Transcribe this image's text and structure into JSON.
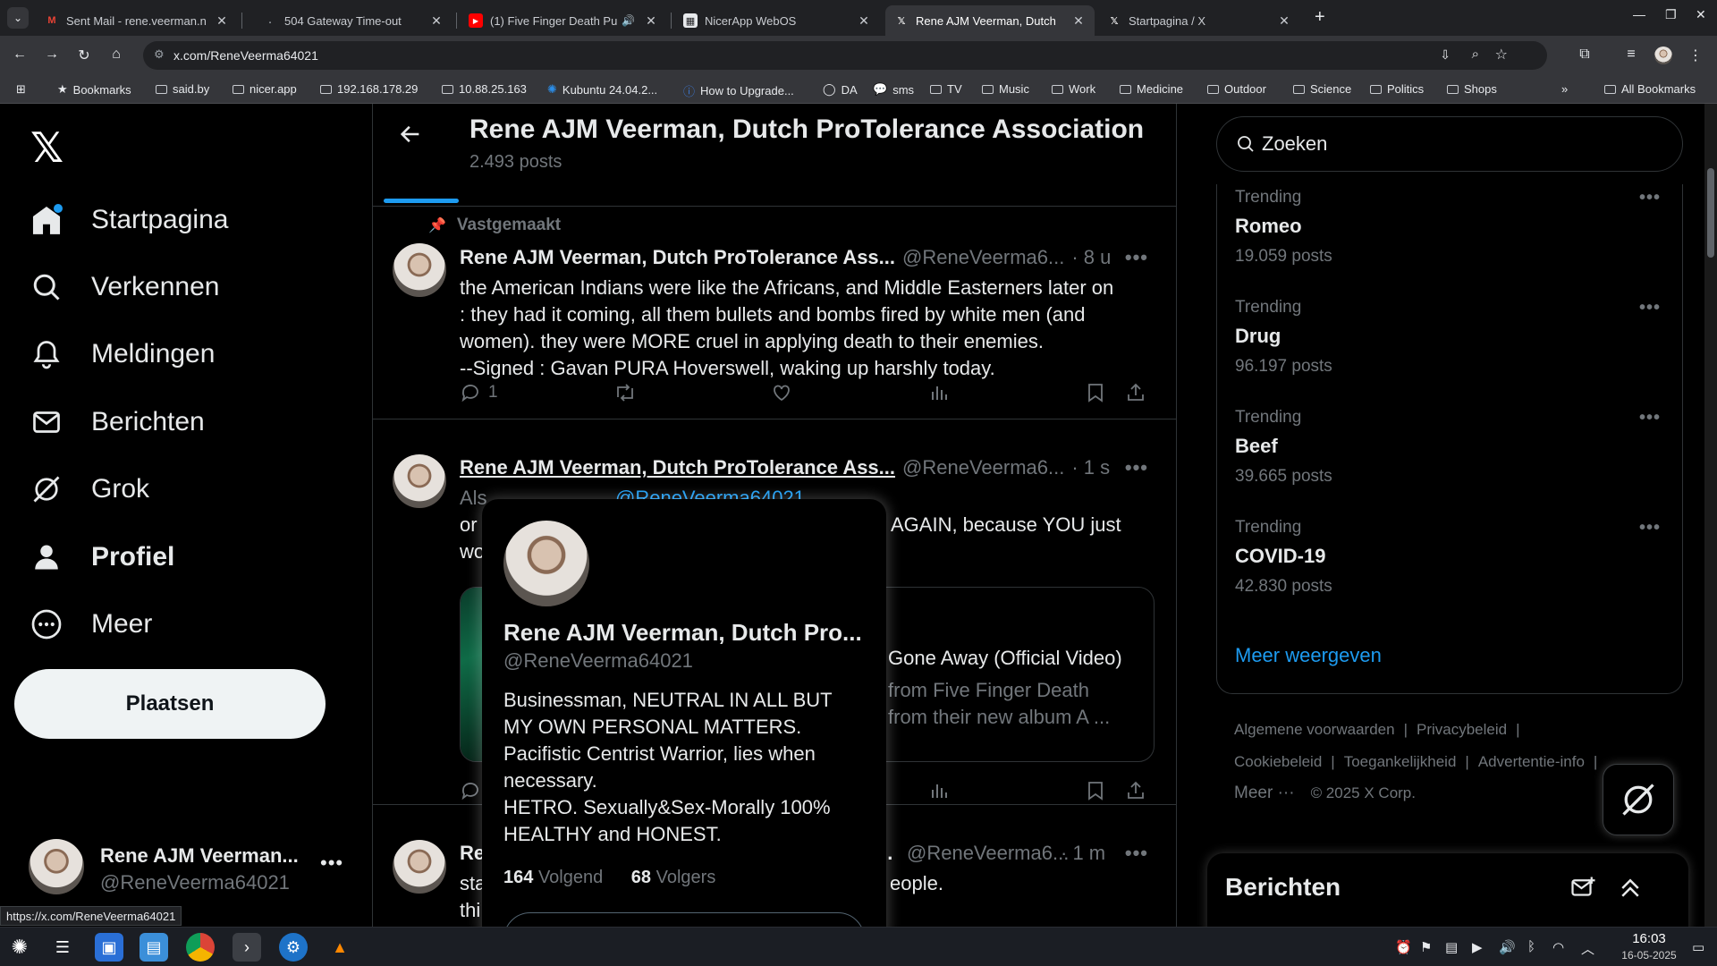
{
  "browser": {
    "tabs": [
      {
        "title": "Sent Mail - rene.veerman.n",
        "favicon": "gmail",
        "active": false
      },
      {
        "title": "504 Gateway Time-out",
        "favicon": "dot",
        "active": false
      },
      {
        "title": "(1) Five Finger Death Pu",
        "favicon": "youtube",
        "active": false
      },
      {
        "title": "NicerApp WebOS",
        "favicon": "grid",
        "active": false
      },
      {
        "title": "Rene AJM Veerman, Dutch",
        "favicon": "x",
        "active": true
      },
      {
        "title": "Startpagina / X",
        "favicon": "x",
        "active": false
      }
    ],
    "url": "x.com/ReneVeerma64021",
    "bookmarks": [
      "Bookmarks",
      "said.by",
      "nicer.app",
      "192.168.178.29",
      "10.88.25.163",
      "Kubuntu 24.04.2...",
      "How to Upgrade...",
      "DA",
      "sms",
      "TV",
      "Music",
      "Work",
      "Medicine",
      "Outdoor",
      "Science",
      "Politics",
      "Shops"
    ],
    "all_bookmarks": "All Bookmarks",
    "status_url": "https://x.com/ReneVeerma64021"
  },
  "nav": {
    "items": [
      {
        "label": "Startpagina",
        "icon": "home-icon"
      },
      {
        "label": "Verkennen",
        "icon": "search-icon"
      },
      {
        "label": "Meldingen",
        "icon": "bell-icon"
      },
      {
        "label": "Berichten",
        "icon": "mail-icon"
      },
      {
        "label": "Grok",
        "icon": "grok-icon"
      },
      {
        "label": "Profiel",
        "icon": "person-icon"
      },
      {
        "label": "Meer",
        "icon": "more-circle-icon"
      }
    ],
    "post_label": "Plaatsen",
    "account_name": "Rene AJM Veerman...",
    "account_handle": "@ReneVeerma64021"
  },
  "header": {
    "title": "Rene AJM Veerman, Dutch ProTolerance Association",
    "post_count": "2.493 posts"
  },
  "tweets": [
    {
      "pinned_label": "Vastgemaakt",
      "name": "Rene AJM Veerman, Dutch ProTolerance Ass...",
      "handle": "@ReneVeerma6...",
      "time": "· 8 u",
      "lines": [
        "the American Indians were like the Africans, and Middle Easterners later on",
        ": they had it coming, all them bullets and bombs fired by white men (and",
        "women). they were MORE cruel in applying death to their enemies.",
        "--Signed : Gavan PURA Hoverswell, waking up harshly today."
      ],
      "reply_count": "1"
    },
    {
      "name": "Rene AJM Veerman, Dutch ProTolerance Ass...",
      "handle": "@ReneVeerma6...",
      "time": "· 1 s",
      "line1_left": "Als",
      "line1_right": "@ReneVeerma64021",
      "line2_left": "or",
      "line2_right": "AGAIN, because YOU just",
      "line3_left": "wo",
      "card_title": "Gone Away (Official Video)",
      "card_desc1": "from Five Finger Death",
      "card_desc2": "from their new album A ..."
    },
    {
      "name": "Re",
      "name_right": "...",
      "handle": "@ReneVeerma6...",
      "time": "· 1 m",
      "line1_left": "sta",
      "line1_right": "eople.",
      "line2_left": "thi"
    }
  ],
  "hovercard": {
    "name": "Rene AJM Veerman, Dutch Pro...",
    "handle": "@ReneVeerma64021",
    "bio": [
      "Businessman, NEUTRAL IN ALL BUT",
      "MY OWN PERSONAL MATTERS.",
      "Pacifistic Centrist Warrior, lies when",
      "necessary.",
      "HETRO. Sexually&Sex-Morally 100%",
      "HEALTHY and HONEST."
    ],
    "following_count": "164",
    "following_label": "Volgend",
    "followers_count": "68",
    "followers_label": "Volgers"
  },
  "sidebar": {
    "search_placeholder": "Zoeken",
    "trends": [
      {
        "label": "Trending",
        "topic": "Romeo",
        "count": "19.059 posts"
      },
      {
        "label": "Trending",
        "topic": "Drug",
        "count": "96.197 posts"
      },
      {
        "label": "Trending",
        "topic": "Beef",
        "count": "39.665 posts"
      },
      {
        "label": "Trending",
        "topic": "COVID-19",
        "count": "42.830 posts"
      }
    ],
    "show_more": "Meer weergeven",
    "footer": {
      "terms": "Algemene voorwaarden",
      "privacy": "Privacybeleid",
      "cookies": "Cookiebeleid",
      "accessibility": "Toegankelijkheid",
      "ads": "Advertentie-info",
      "more": "Meer ···",
      "copyright": "© 2025 X Corp."
    },
    "messages_title": "Berichten"
  },
  "taskbar": {
    "time": "16:03",
    "date": "16-05-2025"
  },
  "colors": {
    "accent": "#1d9bf0",
    "background": "#000000",
    "text": "#e7e9ea",
    "muted": "#71767b"
  }
}
